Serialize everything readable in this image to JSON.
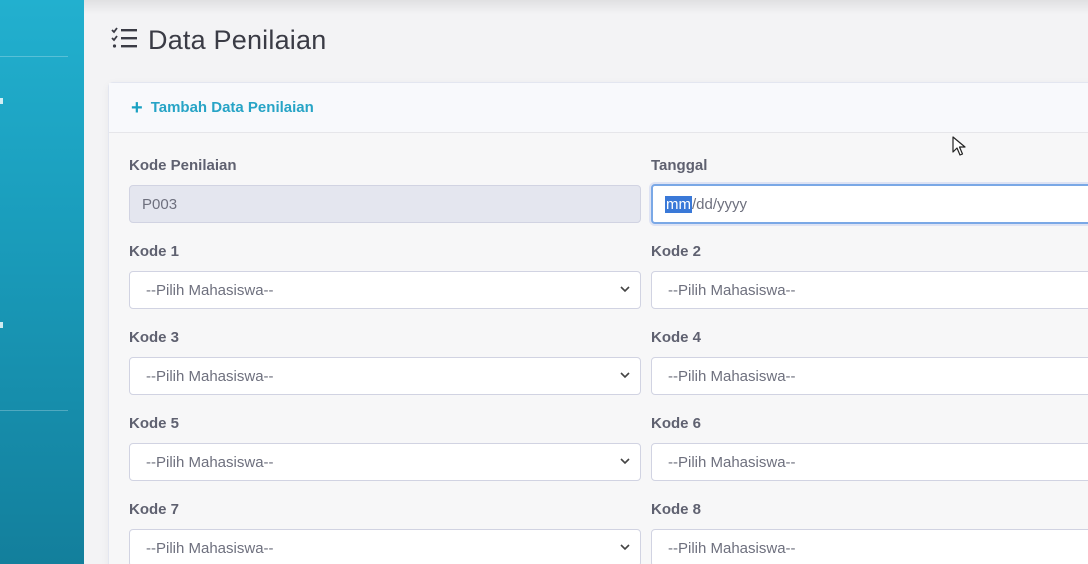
{
  "page": {
    "title": "Data Penilaian",
    "icon": "tasks-list-icon"
  },
  "card": {
    "header_label": "Tambah Data Penilaian",
    "header_icon": "plus-icon"
  },
  "form": {
    "kode_penilaian": {
      "label": "Kode Penilaian",
      "value": "P003"
    },
    "tanggal": {
      "label": "Tanggal",
      "highlighted": "mm",
      "rest": "/dd/yyyy"
    },
    "selects": [
      {
        "label": "Kode 1",
        "value": "--Pilih Mahasiswa--"
      },
      {
        "label": "Kode 2",
        "value": "--Pilih Mahasiswa--"
      },
      {
        "label": "Kode 3",
        "value": "--Pilih Mahasiswa--"
      },
      {
        "label": "Kode 4",
        "value": "--Pilih Mahasiswa--"
      },
      {
        "label": "Kode 5",
        "value": "--Pilih Mahasiswa--"
      },
      {
        "label": "Kode 6",
        "value": "--Pilih Mahasiswa--"
      },
      {
        "label": "Kode 7",
        "value": "--Pilih Mahasiswa--"
      },
      {
        "label": "Kode 8",
        "value": "--Pilih Mahasiswa--"
      }
    ]
  },
  "colors": {
    "sidebar": "#1a9dbc",
    "accent": "#27a4c6",
    "selection": "#3a79d8"
  }
}
